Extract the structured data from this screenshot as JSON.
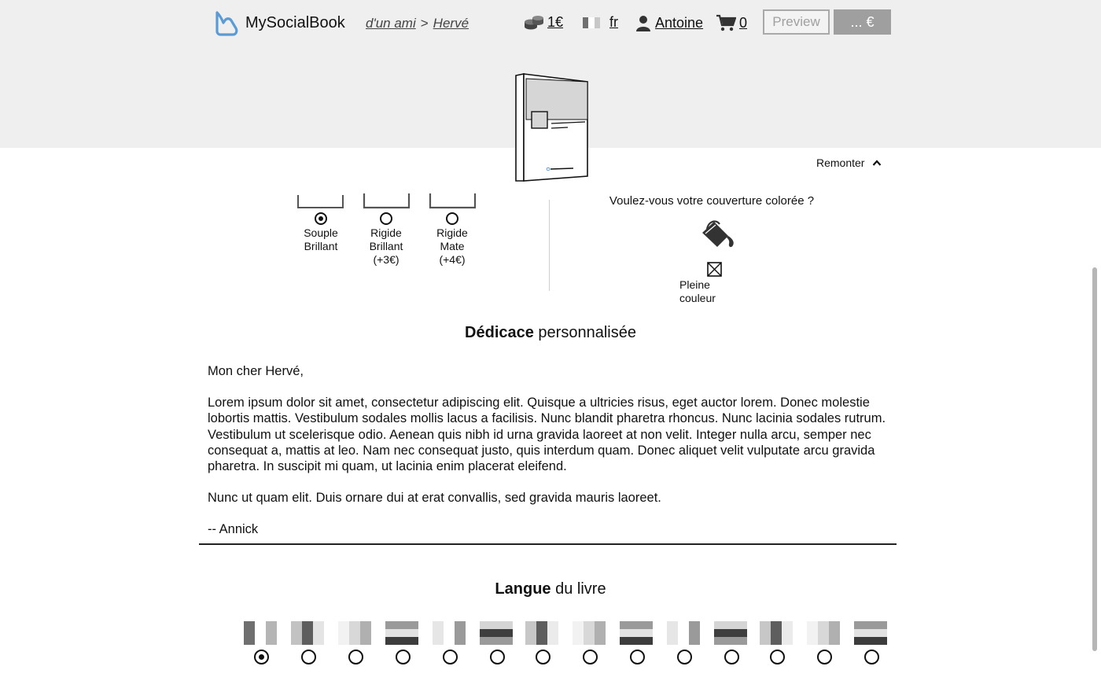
{
  "header": {
    "logo_text": "MySocialBook",
    "breadcrumb": {
      "first": "d'un ami",
      "separator": ">",
      "second": "Hervé"
    },
    "credits": "1€",
    "language": "fr",
    "user": "Antoine",
    "cart_count": "0",
    "preview_label": "Preview",
    "price_label": "... €"
  },
  "remonter_label": "Remonter",
  "cover_options": [
    {
      "line1": "Souple",
      "line2": "Brillant",
      "line3": "",
      "selected": true
    },
    {
      "line1": "Rigide",
      "line2": "Brillant",
      "line3": "(+3€)",
      "selected": false
    },
    {
      "line1": "Rigide",
      "line2": "Mate",
      "line3": "(+4€)",
      "selected": false
    }
  ],
  "color_question": "Voulez-vous votre couverture colorée ?",
  "full_color": {
    "line1": "Pleine",
    "line2": "couleur"
  },
  "dedication": {
    "title_bold": "Dédicace",
    "title_rest": " personnalisée",
    "greeting": "Mon cher Hervé,",
    "paragraph1": "Lorem ipsum dolor sit amet, consectetur adipiscing elit. Quisque a ultricies risus, eget auctor lorem. Donec molestie lobortis mattis. Vestibulum sodales mollis lacus a facilisis. Nunc blandit pharetra rhoncus. Nunc lacinia sodales rutrum. Vestibulum ut scelerisque odio. Aenean quis nibh id urna gravida laoreet at non velit. Integer nulla arcu, semper nec consequat a, mattis at leo. Nam nec consequat justo, quis interdum quam. Donec aliquet velit vulputate arcu gravida pharetra. In suscipit mi quam, ut lacinia enim placerat eleifend.",
    "paragraph2": "Nunc ut quam elit. Duis ornare dui at erat convallis, sed gravida mauris laoreet.",
    "signature": "-- Annick"
  },
  "language_section": {
    "title_bold": "Langue",
    "title_rest": " du livre",
    "flags": [
      {
        "dir": "v",
        "colors": [
          "#6f6f6f",
          "#ffffff",
          "#b5b5b5"
        ],
        "selected": true
      },
      {
        "dir": "v",
        "colors": [
          "#c2c2c2",
          "#5e5e5e",
          "#e4e4e4"
        ],
        "selected": false
      },
      {
        "dir": "v",
        "colors": [
          "#f2f2f2",
          "#d8d8d8",
          "#b0b0b0"
        ],
        "selected": false
      },
      {
        "dir": "h",
        "colors": [
          "#9a9a9a",
          "#e2e2e2",
          "#3c3c3c"
        ],
        "selected": false
      },
      {
        "dir": "v",
        "colors": [
          "#e6e6e6",
          "#ffffff",
          "#9a9a9a"
        ],
        "selected": false
      },
      {
        "dir": "h",
        "colors": [
          "#d5d5d5",
          "#3e3e3e",
          "#9a9a9a"
        ],
        "selected": false
      },
      {
        "dir": "v",
        "colors": [
          "#c7c7c7",
          "#5e5e5e",
          "#ebebeb"
        ],
        "selected": false
      },
      {
        "dir": "v",
        "colors": [
          "#f2f2f2",
          "#d8d8d8",
          "#b0b0b0"
        ],
        "selected": false
      },
      {
        "dir": "h",
        "colors": [
          "#9a9a9a",
          "#e2e2e2",
          "#3c3c3c"
        ],
        "selected": false
      },
      {
        "dir": "v",
        "colors": [
          "#e6e6e6",
          "#ffffff",
          "#9a9a9a"
        ],
        "selected": false
      },
      {
        "dir": "h",
        "colors": [
          "#d5d5d5",
          "#3e3e3e",
          "#9a9a9a"
        ],
        "selected": false
      },
      {
        "dir": "v",
        "colors": [
          "#c7c7c7",
          "#5e5e5e",
          "#ebebeb"
        ],
        "selected": false
      },
      {
        "dir": "v",
        "colors": [
          "#f2f2f2",
          "#d8d8d8",
          "#b0b0b0"
        ],
        "selected": false
      },
      {
        "dir": "h",
        "colors": [
          "#9a9a9a",
          "#e2e2e2",
          "#3c3c3c"
        ],
        "selected": false
      }
    ]
  }
}
